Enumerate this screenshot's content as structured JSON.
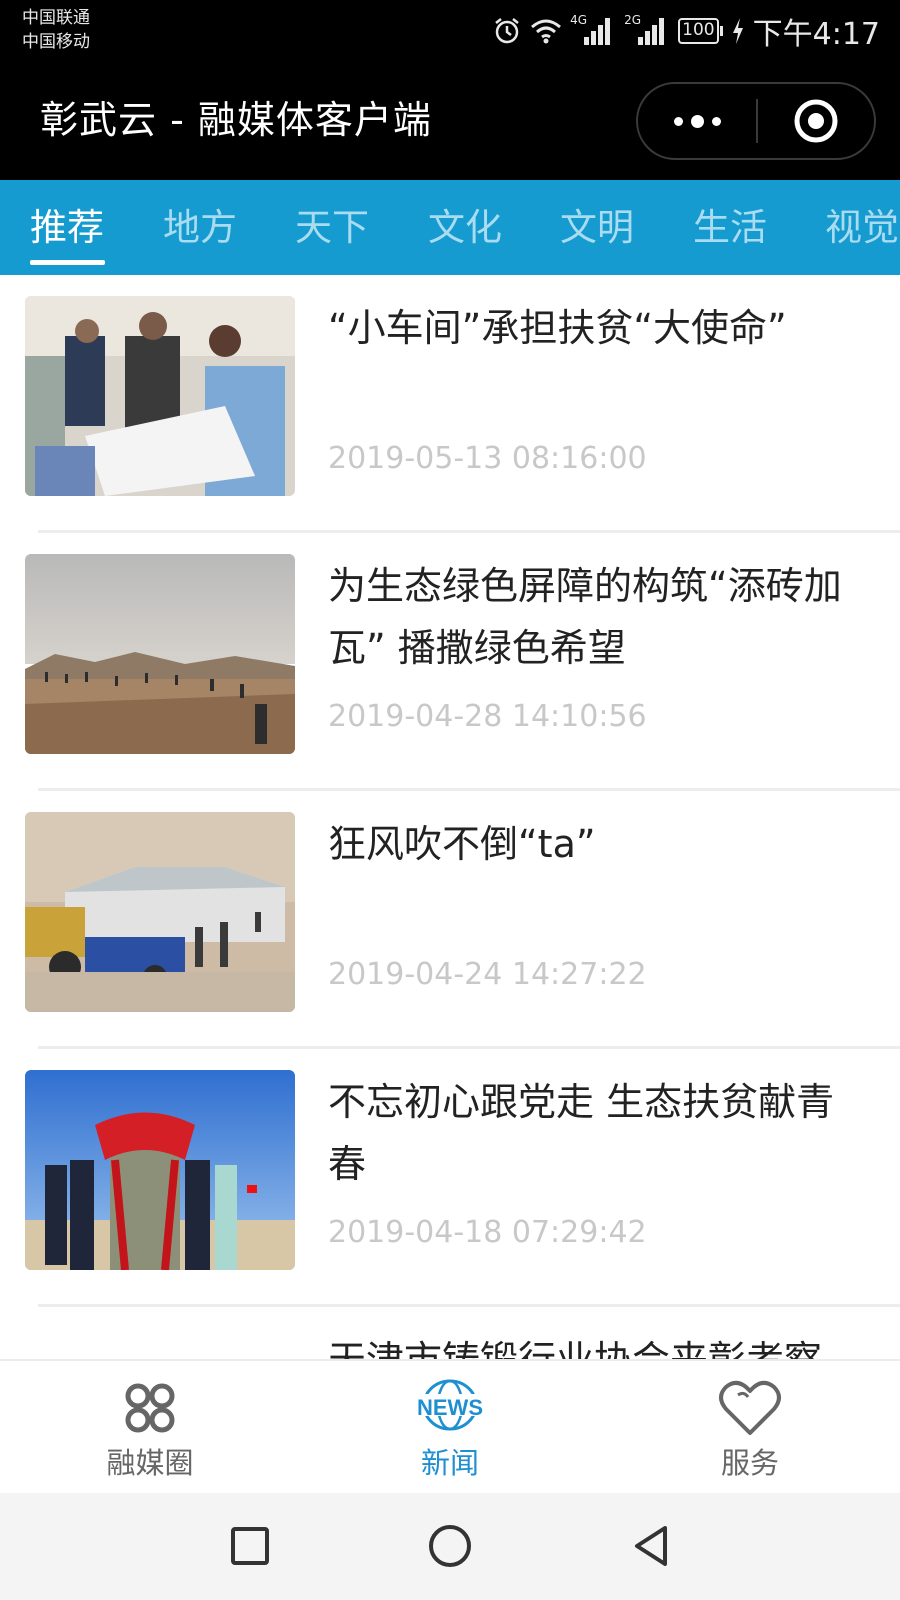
{
  "statusbar": {
    "carrier_1": "中国联通",
    "carrier_2": "中国移动",
    "network_1": "4G",
    "network_2": "2G",
    "battery": "100",
    "time": "下午4:17"
  },
  "titlebar": {
    "title": "彰武云 - 融媒体客户端",
    "more_icon": "more-dots-icon",
    "home_icon": "target-circle-icon"
  },
  "tabs": [
    {
      "label": "推荐",
      "active": true
    },
    {
      "label": "地方",
      "active": false
    },
    {
      "label": "天下",
      "active": false
    },
    {
      "label": "文化",
      "active": false
    },
    {
      "label": "文明",
      "active": false
    },
    {
      "label": "生活",
      "active": false
    },
    {
      "label": "视觉",
      "active": false
    }
  ],
  "colors": {
    "tab_bar": "#159bd0",
    "tab_active": "#ffffff",
    "tab_inactive": "#a9dcf1",
    "nav_active": "#1e8fd0"
  },
  "news": [
    {
      "title": "“小车间”承担扶贫“大使命”",
      "date": "2019-05-13 08:16:00"
    },
    {
      "title": "为生态绿色屏障的构筑“添砖加瓦” 播撒绿色希望",
      "date": "2019-04-28 14:10:56"
    },
    {
      "title": "狂风吹不倒“ta”",
      "date": "2019-04-24 14:27:22"
    },
    {
      "title": "不忘初心跟党走 生态扶贫献青春",
      "date": "2019-04-18 07:29:42"
    },
    {
      "title": "天津市铸锻行业协会来彰考察",
      "date": ""
    }
  ],
  "bottom_nav": [
    {
      "label": "融媒圈",
      "icon": "clover-rings-icon",
      "active": false
    },
    {
      "label": "新闻",
      "icon": "news-globe-icon",
      "icon_text": "NEWS",
      "active": true
    },
    {
      "label": "服务",
      "icon": "heart-outline-icon",
      "active": false
    }
  ],
  "system_nav": {
    "recents_icon": "square-icon",
    "home_icon": "circle-icon",
    "back_icon": "triangle-back-icon"
  }
}
